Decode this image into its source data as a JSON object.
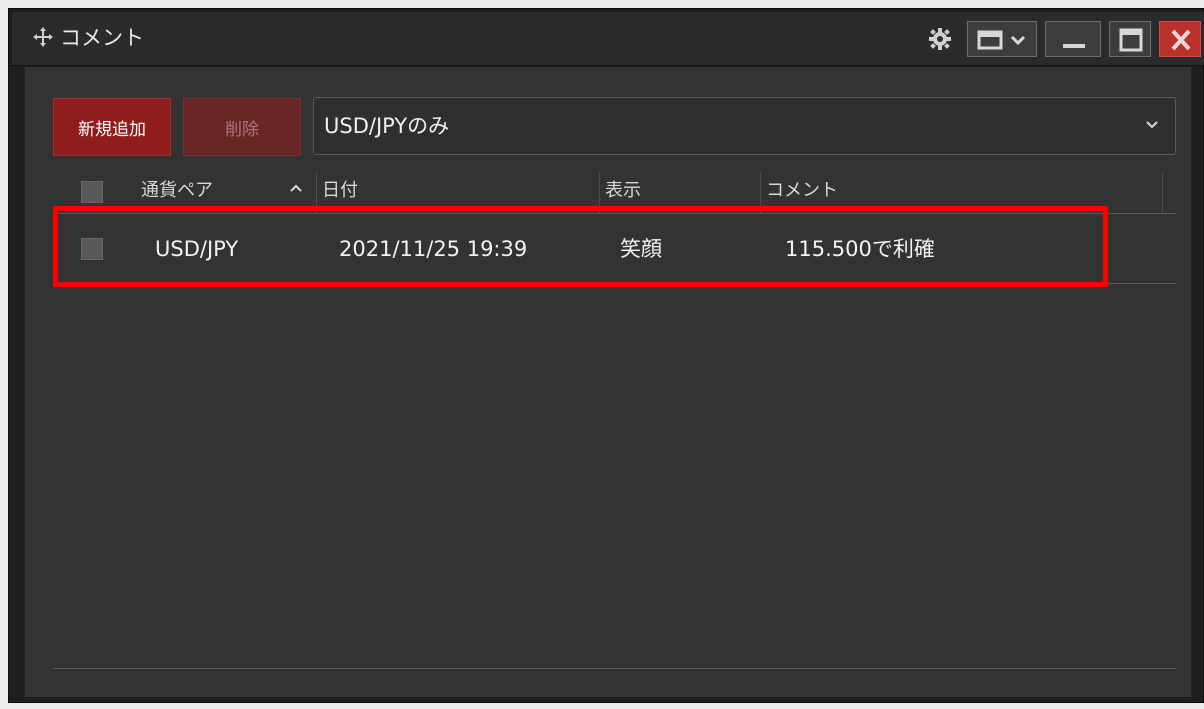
{
  "window": {
    "title": "コメント",
    "icons": {
      "move": "move-icon",
      "settings": "gear-icon",
      "layout": "layout-dropdown-icon",
      "minimize": "minimize-icon",
      "maximize": "maximize-icon",
      "close": "close-icon"
    },
    "colors": {
      "close": "#b9312a",
      "accent": "#8f1d1d",
      "highlight": "#ff0000"
    }
  },
  "toolbar": {
    "add_label": "新規追加",
    "delete_label": "削除",
    "filter_value": "USD/JPYのみ"
  },
  "table": {
    "headers": {
      "pair": "通貨ペア",
      "date": "日付",
      "display": "表示",
      "comment": "コメント"
    },
    "sort_column": "pair",
    "rows": [
      {
        "pair": "USD/JPY",
        "date": "2021/11/25 19:39",
        "display": "笑顔",
        "comment": "115.500で利確"
      }
    ]
  }
}
